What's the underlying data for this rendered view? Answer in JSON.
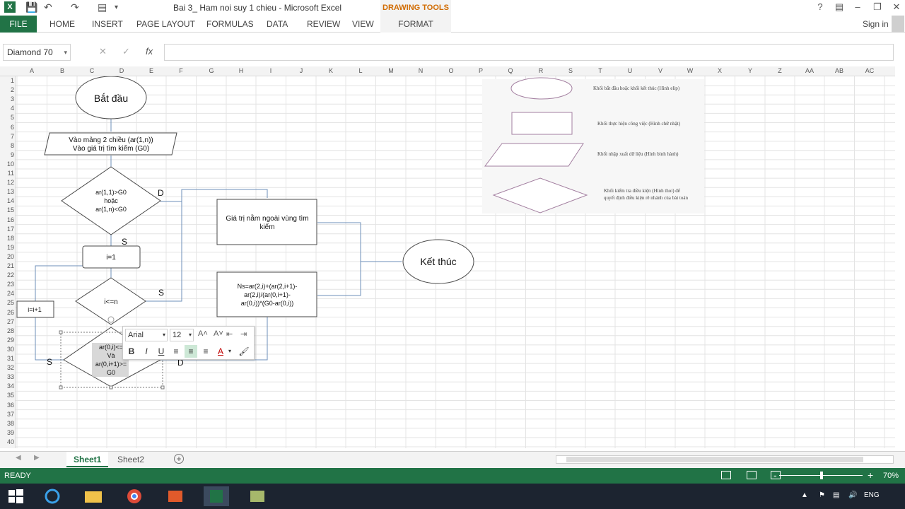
{
  "window": {
    "title": "Bai 3_ Ham noi suy 1 chieu - Microsoft Excel",
    "context_group": "DRAWING TOOLS",
    "help": "?",
    "app_icon": "X"
  },
  "ribbon": {
    "file": "FILE",
    "tabs": [
      "HOME",
      "INSERT",
      "PAGE LAYOUT",
      "FORMULAS",
      "DATA",
      "REVIEW",
      "VIEW"
    ],
    "format": "FORMAT",
    "signin": "Sign in"
  },
  "formula_bar": {
    "name_box": "Diamond 70",
    "fx": "fx",
    "cancel": "✕",
    "enter": "✓",
    "value": ""
  },
  "columns": [
    "A",
    "B",
    "C",
    "D",
    "E",
    "F",
    "G",
    "H",
    "I",
    "J",
    "K",
    "L",
    "M",
    "N",
    "O",
    "P",
    "Q",
    "R",
    "S",
    "T",
    "U",
    "V",
    "W",
    "X",
    "Y",
    "Z",
    "AA",
    "AB",
    "AC"
  ],
  "rows": [
    "1",
    "2",
    "3",
    "4",
    "5",
    "6",
    "7",
    "8",
    "9",
    "10",
    "11",
    "12",
    "13",
    "14",
    "15",
    "16",
    "17",
    "18",
    "19",
    "20",
    "21",
    "22",
    "23",
    "24",
    "25",
    "26",
    "27",
    "28",
    "29",
    "30",
    "31",
    "32",
    "33",
    "34",
    "35",
    "36",
    "37",
    "38",
    "39",
    "40"
  ],
  "flowchart": {
    "start": "Bắt đầu",
    "input_line1": "Vào mảng 2 chiều (ar(1,n))",
    "input_line2": "Vào giá trị tìm kiếm (G0)",
    "cond1_line1": "ar(1,1)>G0",
    "cond1_line2": "hoặc",
    "cond1_line3": "ar(1,n)<G0",
    "label_d": "D",
    "label_s": "S",
    "init": "i=1",
    "loop_cond": "i<=n",
    "increment": "i=i+1",
    "outside_line1": "Giá trị nằm ngoài vùng tìm",
    "outside_line2": "kiếm",
    "formula_line1": "Ns=ar(2,i)+(ar(2,i+1)-",
    "formula_line2": "ar(2,i)/(ar(0,i+1)-",
    "formula_line3": "ar(0,i))*(G0-ar(0,i))",
    "cond2_line1": "ar(0,i)<=",
    "cond2_line2": "Và",
    "cond2_line3": "ar(0,i+1)>=",
    "cond2_line4": "G0",
    "end": "Kết thúc"
  },
  "legend": {
    "oval": "Khối bắt đầu hoặc khối kết thúc (Hình elip)",
    "rect": "Khối thực hiện công việc (Hình chữ nhật)",
    "parallelogram": "Khối nhập xuất dữ liệu (Hình bình hành)",
    "diamond_line1": "Khối kiểm tra điều kiện (Hình thoi) để",
    "diamond_line2": "quyết định điều kiện rẽ nhánh của bài toán"
  },
  "mini_toolbar": {
    "font": "Arial",
    "size": "12",
    "bold": "B",
    "italic": "I",
    "underline": "U",
    "font_color": "A"
  },
  "sheets": [
    "Sheet1",
    "Sheet2"
  ],
  "status": {
    "ready": "READY",
    "zoom": "70%",
    "zoom_minus": "-",
    "zoom_plus": "+"
  },
  "tray": {
    "lang": "ENG"
  },
  "colors": {
    "excel_green": "#217346",
    "context_orange": "#d16b00",
    "shape_border": "#4a4a4a",
    "connector": "#6d8fb8",
    "legend_shape": "#a37fa0"
  }
}
